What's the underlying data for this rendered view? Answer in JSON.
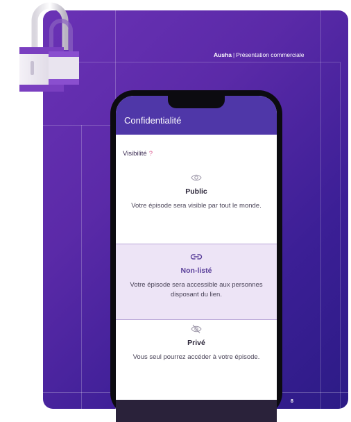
{
  "header": {
    "brand": "Ausha",
    "separator": "|",
    "subtitle": "Présentation commerciale"
  },
  "page_number": "8",
  "app": {
    "title": "Confidentialité",
    "visibility_label": "Visibilité",
    "required_mark": "?",
    "options": [
      {
        "title": "Public",
        "description": "Votre épisode sera visible par tout le monde.",
        "icon": "eye-icon",
        "selected": false
      },
      {
        "title": "Non-listé",
        "description": "Votre épisode sera accessible aux personnes disposant du lien.",
        "icon": "link-icon",
        "selected": true
      },
      {
        "title": "Privé",
        "description": "Vous seul pourrez accéder à votre épisode.",
        "icon": "eye-off-icon",
        "selected": false
      }
    ]
  },
  "colors": {
    "slide_gradient_start": "#6a32b5",
    "slide_gradient_end": "#2c1b86",
    "appbar": "#4f37a8",
    "selected_bg": "#ede4f6",
    "accent": "#5a3f9a"
  }
}
